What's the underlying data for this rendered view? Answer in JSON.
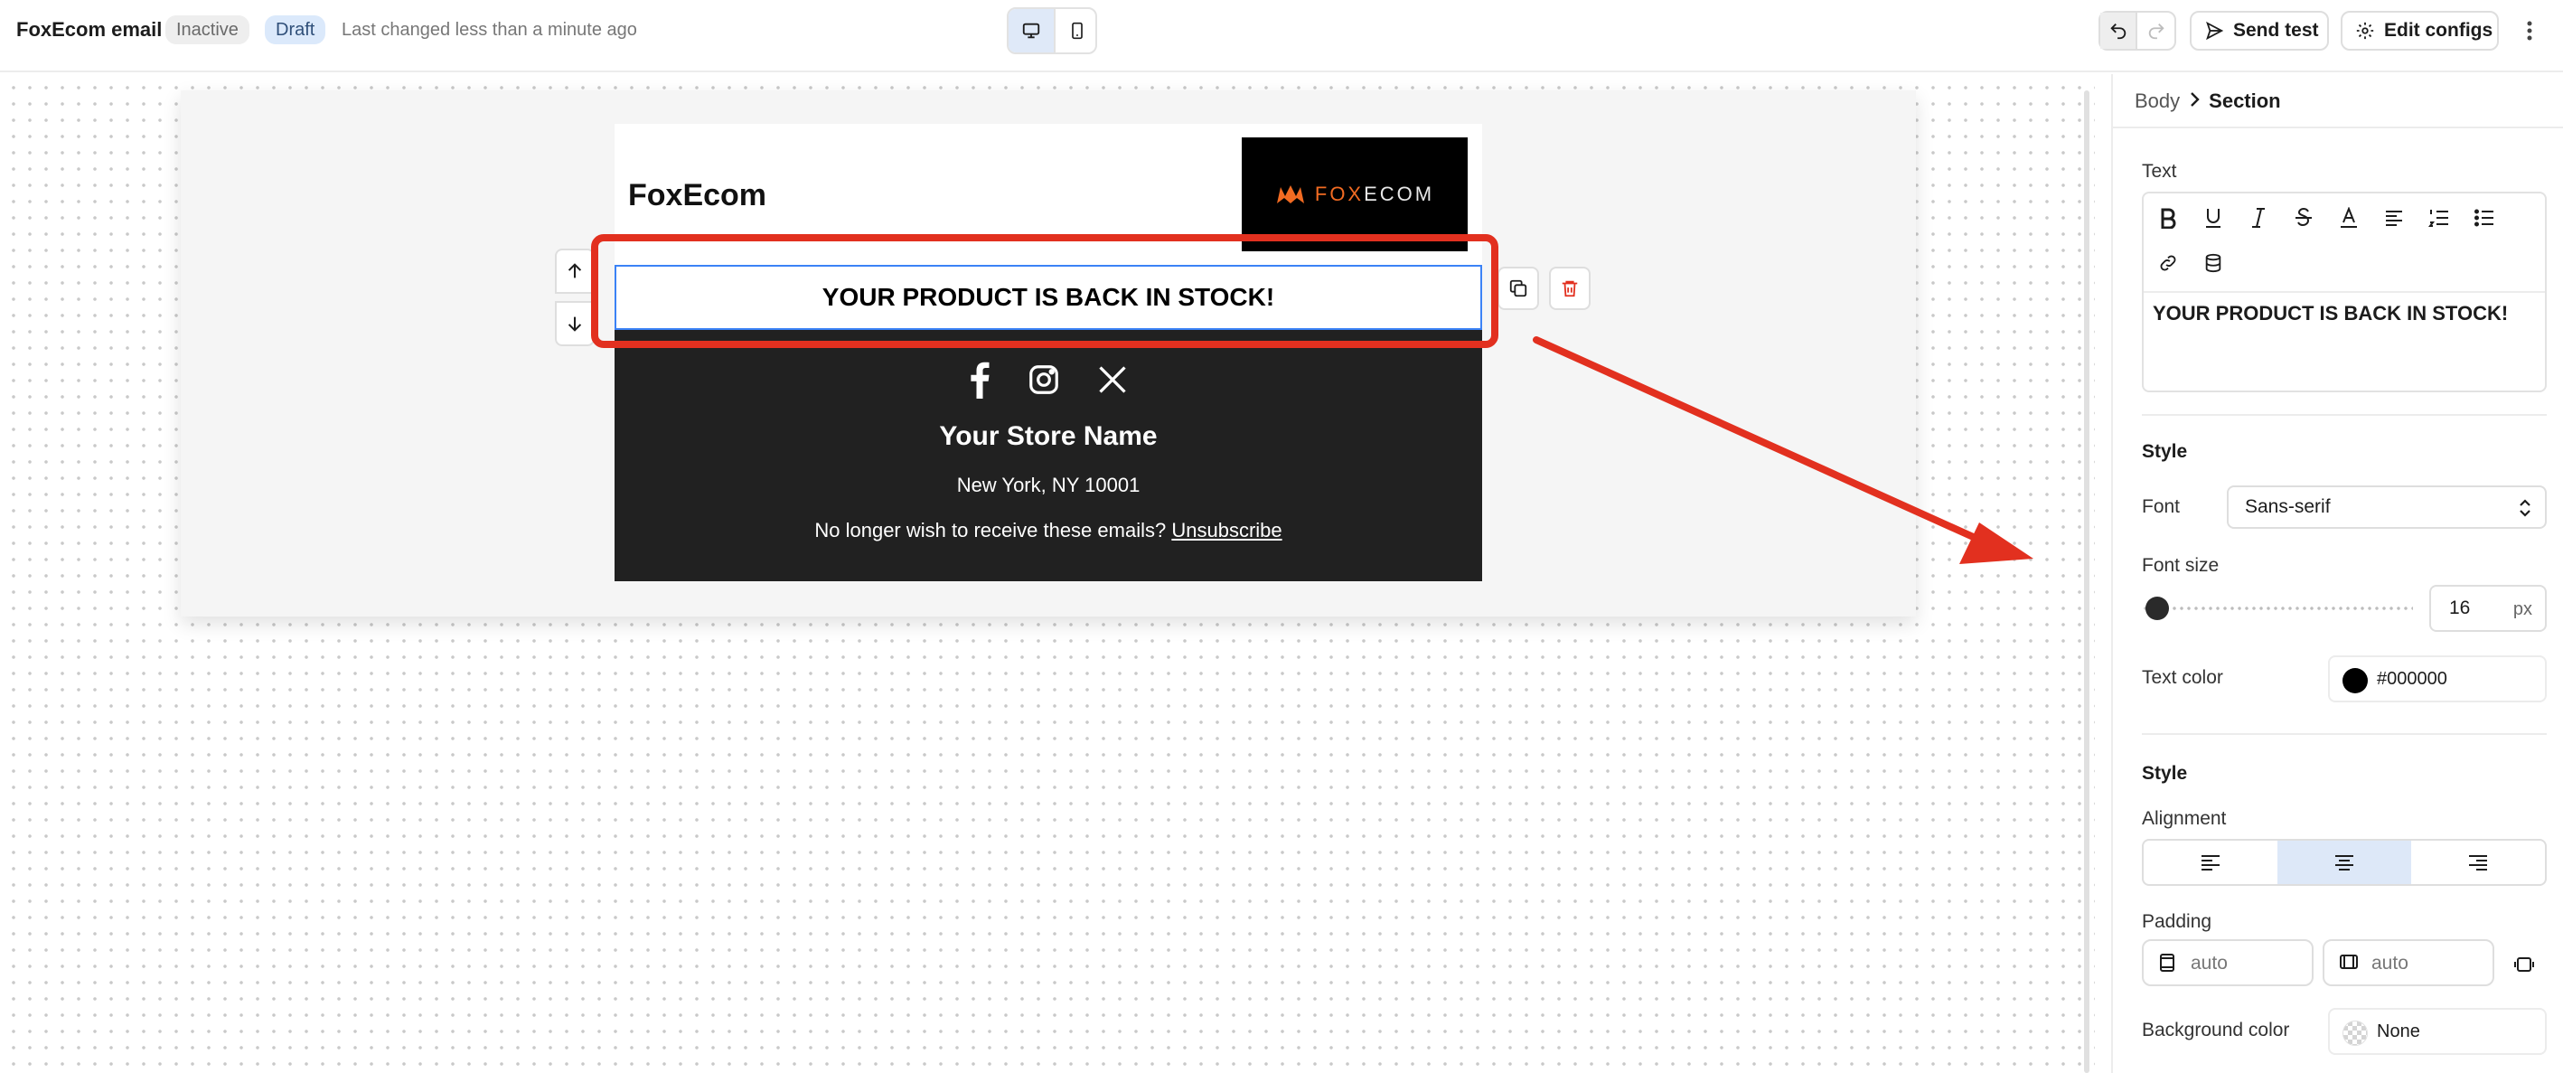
{
  "topbar": {
    "title": "FoxEcom email",
    "status_inactive": "Inactive",
    "status_draft": "Draft",
    "last_changed": "Last changed less than a minute ago",
    "send_test_label": "Send test",
    "edit_configs_label": "Edit configs"
  },
  "email": {
    "brand_name": "FoxEcom",
    "logo_text_fox": "FOX",
    "logo_text_ecom": "ECOM",
    "headline": "YOUR PRODUCT IS BACK IN STOCK!",
    "footer": {
      "store_name": "Your Store Name",
      "address": "New York, NY 10001",
      "unsubscribe_prompt": "No longer wish to receive these emails?",
      "unsubscribe_link": "Unsubscribe"
    }
  },
  "panel": {
    "breadcrumb": {
      "parent": "Body",
      "current": "Section"
    },
    "text_section_label": "Text",
    "text_content": "YOUR PRODUCT IS BACK IN STOCK!",
    "style_label_1": "Style",
    "font_label": "Font",
    "font_value": "Sans-serif",
    "font_size_label": "Font size",
    "font_size_value": "16",
    "font_size_unit": "px",
    "text_color_label": "Text color",
    "text_color_value": "#000000",
    "style_label_2": "Style",
    "alignment_label": "Alignment",
    "alignment_selected": "center",
    "padding_label": "Padding",
    "padding_vertical": "auto",
    "padding_horizontal": "auto",
    "background_color_label": "Background color",
    "background_color_value": "None"
  },
  "colors": {
    "accent_blue": "#3b82f6",
    "annotation_red": "#e2301f",
    "footer_bg": "#212121",
    "logo_orange": "#f26b22"
  },
  "icons": [
    "desktop-icon",
    "mobile-icon",
    "undo-icon",
    "redo-icon",
    "send-icon",
    "gear-icon",
    "kebab-icon",
    "arrow-up-icon",
    "arrow-down-icon",
    "copy-icon",
    "trash-icon",
    "facebook-icon",
    "instagram-icon",
    "x-icon",
    "bold-icon",
    "underline-icon",
    "italic-icon",
    "strikethrough-icon",
    "text-color-icon",
    "align-icon",
    "ordered-list-icon",
    "bullet-list-icon",
    "link-icon",
    "database-icon",
    "chevron-right-icon",
    "chevron-updown-icon",
    "align-left-icon",
    "align-center-icon",
    "align-right-icon",
    "padding-vertical-icon",
    "padding-horizontal-icon",
    "padding-individual-icon"
  ]
}
